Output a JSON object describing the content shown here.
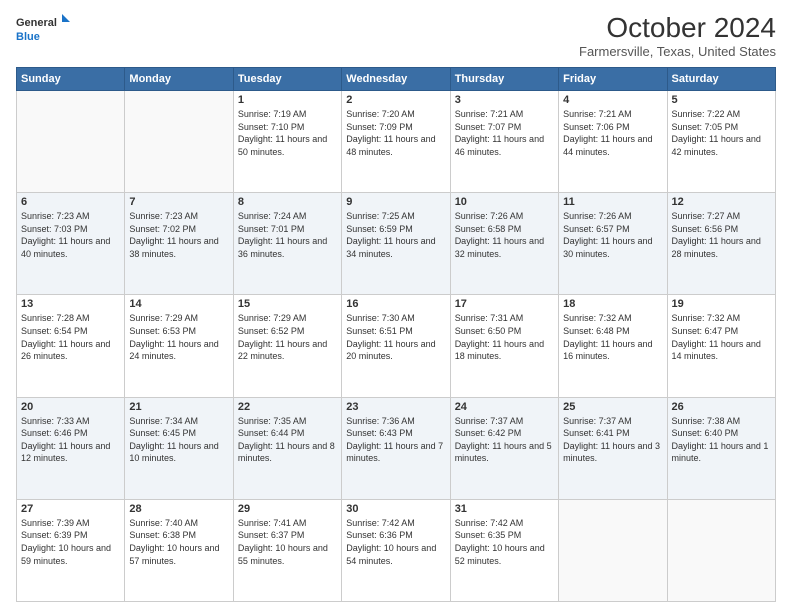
{
  "header": {
    "logo_line1": "General",
    "logo_line2": "Blue",
    "title": "October 2024",
    "subtitle": "Farmersville, Texas, United States"
  },
  "days_of_week": [
    "Sunday",
    "Monday",
    "Tuesday",
    "Wednesday",
    "Thursday",
    "Friday",
    "Saturday"
  ],
  "weeks": [
    [
      {
        "day": "",
        "sunrise": "",
        "sunset": "",
        "daylight": ""
      },
      {
        "day": "",
        "sunrise": "",
        "sunset": "",
        "daylight": ""
      },
      {
        "day": "1",
        "sunrise": "Sunrise: 7:19 AM",
        "sunset": "Sunset: 7:10 PM",
        "daylight": "Daylight: 11 hours and 50 minutes."
      },
      {
        "day": "2",
        "sunrise": "Sunrise: 7:20 AM",
        "sunset": "Sunset: 7:09 PM",
        "daylight": "Daylight: 11 hours and 48 minutes."
      },
      {
        "day": "3",
        "sunrise": "Sunrise: 7:21 AM",
        "sunset": "Sunset: 7:07 PM",
        "daylight": "Daylight: 11 hours and 46 minutes."
      },
      {
        "day": "4",
        "sunrise": "Sunrise: 7:21 AM",
        "sunset": "Sunset: 7:06 PM",
        "daylight": "Daylight: 11 hours and 44 minutes."
      },
      {
        "day": "5",
        "sunrise": "Sunrise: 7:22 AM",
        "sunset": "Sunset: 7:05 PM",
        "daylight": "Daylight: 11 hours and 42 minutes."
      }
    ],
    [
      {
        "day": "6",
        "sunrise": "Sunrise: 7:23 AM",
        "sunset": "Sunset: 7:03 PM",
        "daylight": "Daylight: 11 hours and 40 minutes."
      },
      {
        "day": "7",
        "sunrise": "Sunrise: 7:23 AM",
        "sunset": "Sunset: 7:02 PM",
        "daylight": "Daylight: 11 hours and 38 minutes."
      },
      {
        "day": "8",
        "sunrise": "Sunrise: 7:24 AM",
        "sunset": "Sunset: 7:01 PM",
        "daylight": "Daylight: 11 hours and 36 minutes."
      },
      {
        "day": "9",
        "sunrise": "Sunrise: 7:25 AM",
        "sunset": "Sunset: 6:59 PM",
        "daylight": "Daylight: 11 hours and 34 minutes."
      },
      {
        "day": "10",
        "sunrise": "Sunrise: 7:26 AM",
        "sunset": "Sunset: 6:58 PM",
        "daylight": "Daylight: 11 hours and 32 minutes."
      },
      {
        "day": "11",
        "sunrise": "Sunrise: 7:26 AM",
        "sunset": "Sunset: 6:57 PM",
        "daylight": "Daylight: 11 hours and 30 minutes."
      },
      {
        "day": "12",
        "sunrise": "Sunrise: 7:27 AM",
        "sunset": "Sunset: 6:56 PM",
        "daylight": "Daylight: 11 hours and 28 minutes."
      }
    ],
    [
      {
        "day": "13",
        "sunrise": "Sunrise: 7:28 AM",
        "sunset": "Sunset: 6:54 PM",
        "daylight": "Daylight: 11 hours and 26 minutes."
      },
      {
        "day": "14",
        "sunrise": "Sunrise: 7:29 AM",
        "sunset": "Sunset: 6:53 PM",
        "daylight": "Daylight: 11 hours and 24 minutes."
      },
      {
        "day": "15",
        "sunrise": "Sunrise: 7:29 AM",
        "sunset": "Sunset: 6:52 PM",
        "daylight": "Daylight: 11 hours and 22 minutes."
      },
      {
        "day": "16",
        "sunrise": "Sunrise: 7:30 AM",
        "sunset": "Sunset: 6:51 PM",
        "daylight": "Daylight: 11 hours and 20 minutes."
      },
      {
        "day": "17",
        "sunrise": "Sunrise: 7:31 AM",
        "sunset": "Sunset: 6:50 PM",
        "daylight": "Daylight: 11 hours and 18 minutes."
      },
      {
        "day": "18",
        "sunrise": "Sunrise: 7:32 AM",
        "sunset": "Sunset: 6:48 PM",
        "daylight": "Daylight: 11 hours and 16 minutes."
      },
      {
        "day": "19",
        "sunrise": "Sunrise: 7:32 AM",
        "sunset": "Sunset: 6:47 PM",
        "daylight": "Daylight: 11 hours and 14 minutes."
      }
    ],
    [
      {
        "day": "20",
        "sunrise": "Sunrise: 7:33 AM",
        "sunset": "Sunset: 6:46 PM",
        "daylight": "Daylight: 11 hours and 12 minutes."
      },
      {
        "day": "21",
        "sunrise": "Sunrise: 7:34 AM",
        "sunset": "Sunset: 6:45 PM",
        "daylight": "Daylight: 11 hours and 10 minutes."
      },
      {
        "day": "22",
        "sunrise": "Sunrise: 7:35 AM",
        "sunset": "Sunset: 6:44 PM",
        "daylight": "Daylight: 11 hours and 8 minutes."
      },
      {
        "day": "23",
        "sunrise": "Sunrise: 7:36 AM",
        "sunset": "Sunset: 6:43 PM",
        "daylight": "Daylight: 11 hours and 7 minutes."
      },
      {
        "day": "24",
        "sunrise": "Sunrise: 7:37 AM",
        "sunset": "Sunset: 6:42 PM",
        "daylight": "Daylight: 11 hours and 5 minutes."
      },
      {
        "day": "25",
        "sunrise": "Sunrise: 7:37 AM",
        "sunset": "Sunset: 6:41 PM",
        "daylight": "Daylight: 11 hours and 3 minutes."
      },
      {
        "day": "26",
        "sunrise": "Sunrise: 7:38 AM",
        "sunset": "Sunset: 6:40 PM",
        "daylight": "Daylight: 11 hours and 1 minute."
      }
    ],
    [
      {
        "day": "27",
        "sunrise": "Sunrise: 7:39 AM",
        "sunset": "Sunset: 6:39 PM",
        "daylight": "Daylight: 10 hours and 59 minutes."
      },
      {
        "day": "28",
        "sunrise": "Sunrise: 7:40 AM",
        "sunset": "Sunset: 6:38 PM",
        "daylight": "Daylight: 10 hours and 57 minutes."
      },
      {
        "day": "29",
        "sunrise": "Sunrise: 7:41 AM",
        "sunset": "Sunset: 6:37 PM",
        "daylight": "Daylight: 10 hours and 55 minutes."
      },
      {
        "day": "30",
        "sunrise": "Sunrise: 7:42 AM",
        "sunset": "Sunset: 6:36 PM",
        "daylight": "Daylight: 10 hours and 54 minutes."
      },
      {
        "day": "31",
        "sunrise": "Sunrise: 7:42 AM",
        "sunset": "Sunset: 6:35 PM",
        "daylight": "Daylight: 10 hours and 52 minutes."
      },
      {
        "day": "",
        "sunrise": "",
        "sunset": "",
        "daylight": ""
      },
      {
        "day": "",
        "sunrise": "",
        "sunset": "",
        "daylight": ""
      }
    ]
  ]
}
